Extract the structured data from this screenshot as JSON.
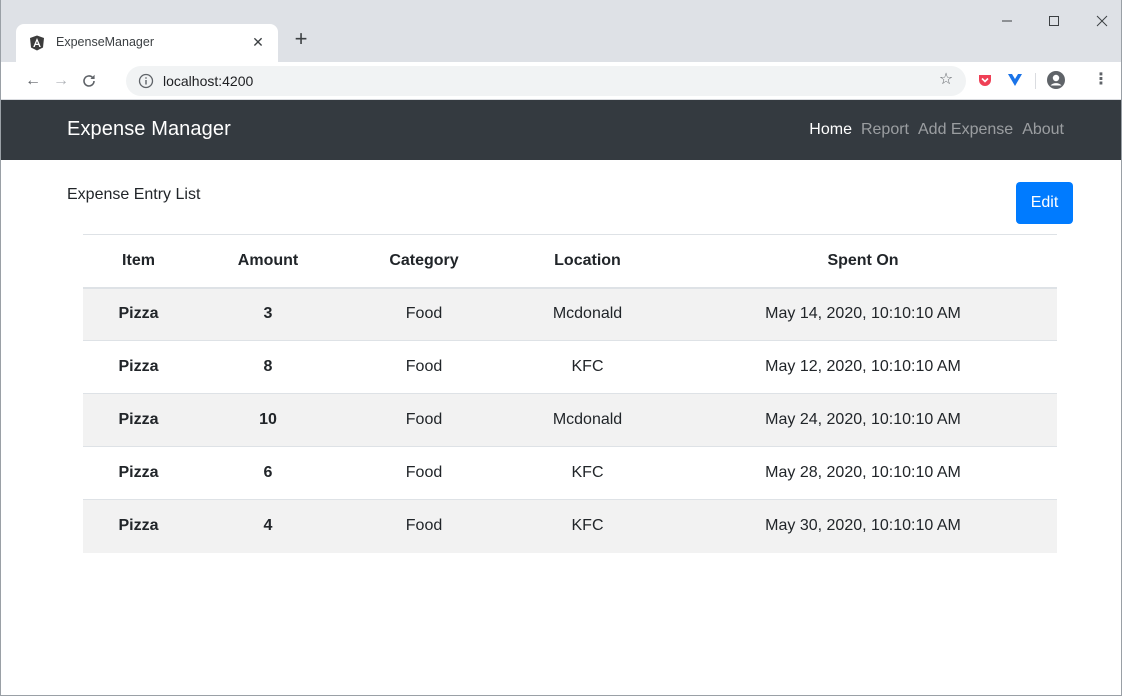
{
  "browser": {
    "tab_title": "ExpenseManager",
    "url": "localhost:4200"
  },
  "navbar": {
    "brand": "Expense Manager",
    "links": [
      {
        "label": "Home",
        "active": true
      },
      {
        "label": "Report",
        "active": false
      },
      {
        "label": "Add Expense",
        "active": false
      },
      {
        "label": "About",
        "active": false
      }
    ]
  },
  "main": {
    "title": "Expense Entry List",
    "edit_label": "Edit",
    "table": {
      "headers": [
        "Item",
        "Amount",
        "Category",
        "Location",
        "Spent On"
      ],
      "rows": [
        [
          "Pizza",
          "3",
          "Food",
          "Mcdonald",
          "May 14, 2020, 10:10:10 AM"
        ],
        [
          "Pizza",
          "8",
          "Food",
          "KFC",
          "May 12, 2020, 10:10:10 AM"
        ],
        [
          "Pizza",
          "10",
          "Food",
          "Mcdonald",
          "May 24, 2020, 10:10:10 AM"
        ],
        [
          "Pizza",
          "6",
          "Food",
          "KFC",
          "May 28, 2020, 10:10:10 AM"
        ],
        [
          "Pizza",
          "4",
          "Food",
          "KFC",
          "May 30, 2020, 10:10:10 AM"
        ]
      ]
    }
  },
  "colors": {
    "navbar_bg": "#343a40",
    "primary": "#007bff",
    "stripe": "#f2f2f2"
  },
  "icons": {
    "favicon": "angular-logo-icon",
    "info": "info-icon",
    "bookmark": "star-icon",
    "profile": "account-circle-icon"
  }
}
